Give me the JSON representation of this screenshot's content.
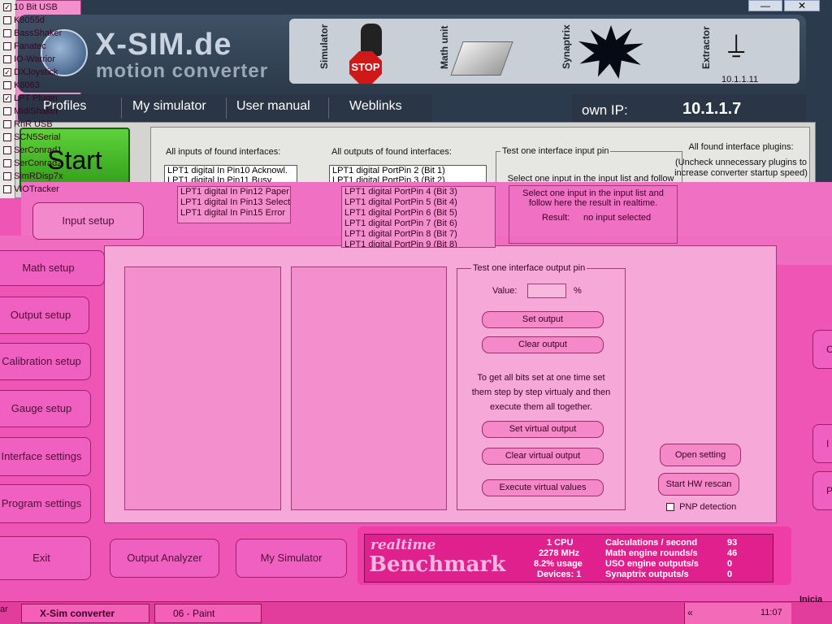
{
  "window": {
    "minimize_glyph": "—",
    "close_glyph": "✕"
  },
  "header": {
    "logo_title": "X-SIM.de",
    "logo_subtitle": "motion converter",
    "modules": {
      "simulator": "Simulator",
      "stop": "STOP",
      "math_unit": "Math unit",
      "synaptrix": "Synaptrix",
      "extractor": "Extractor",
      "extractor_ip": "10.1.1.11"
    }
  },
  "nav": {
    "profiles": "Profiles",
    "my_simulator": "My simulator",
    "user_manual": "User manual",
    "weblinks": "Weblinks"
  },
  "own_ip": {
    "label": "own IP:",
    "value": "10.1.1.7"
  },
  "start_label": "Start",
  "inputs": {
    "heading": "All inputs of found interfaces:",
    "items": [
      "LPT1 digital In Pin10 Acknowl.",
      "LPT1 digital In Pin11 Busy",
      "LPT1 digital In Pin12 Paper End",
      "LPT1 digital In Pin13 Select",
      "LPT1 digital In Pin15 Error"
    ]
  },
  "outputs": {
    "heading": "All outputs of found interfaces:",
    "items": [
      "LPT1 digital PortPin 2 (Bit 1)",
      "LPT1 digital PortPin 3 (Bit 2)",
      "LPT1 digital PortPin 4 (Bit 3)",
      "LPT1 digital PortPin 5 (Bit 4)",
      "LPT1 digital PortPin 6 (Bit 5)",
      "LPT1 digital PortPin 7 (Bit 6)",
      "LPT1 digital PortPin 8 (Bit 7)",
      "LPT1 digital PortPin 9 (Bit 8)"
    ]
  },
  "test_input": {
    "legend": "Test one interface input pin",
    "description": "Select one input in the input list and follow here the result in realtime.",
    "result_label": "Result:",
    "result_value": "no input selected"
  },
  "plugins": {
    "heading": "All found interface plugins:",
    "note": "(Uncheck unnecessary plugins to increase converter startup speed)",
    "items": [
      {
        "name": "10 Bit USB",
        "checked": true
      },
      {
        "name": "K8055d",
        "checked": false
      },
      {
        "name": "BassShaker",
        "checked": false
      },
      {
        "name": "Fanatec",
        "checked": false
      },
      {
        "name": "IO-Warrior",
        "checked": false
      },
      {
        "name": "DXJoystick",
        "checked": true
      },
      {
        "name": "K8063",
        "checked": false
      },
      {
        "name": "LPT Plugin",
        "checked": true
      },
      {
        "name": "MidiShaker",
        "checked": false
      },
      {
        "name": "RnR USB",
        "checked": false
      },
      {
        "name": "SCN5Serial",
        "checked": false
      },
      {
        "name": "SerConrad1",
        "checked": false
      },
      {
        "name": "SerConrad2",
        "checked": false
      },
      {
        "name": "SimRDisp7x",
        "checked": false
      },
      {
        "name": "VIOTracker",
        "checked": false
      }
    ],
    "open_setting": "Open setting",
    "hw_rescan": "Start HW rescan",
    "pnp_detection": "PNP detection"
  },
  "test_output": {
    "legend": "Test one interface output pin",
    "value_label": "Value:",
    "value": "",
    "percent": "%",
    "set_output": "Set output",
    "clear_output": "Clear output",
    "virtual_description": "To get all bits set at one time set them step by step virtualy and then execute them all together.",
    "set_virtual": "Set virtual output",
    "clear_virtual": "Clear virtual output",
    "execute_virtual": "Execute virtual values"
  },
  "side_menu": {
    "input_setup": "Input setup",
    "math_setup": "Math setup",
    "output_setup": "Output setup",
    "calibration_setup": "Calibration setup",
    "gauge_setup": "Gauge setup",
    "interface_settings": "Interface settings",
    "program_settings": "Program settings",
    "exit": "Exit"
  },
  "bottom": {
    "output_analyzer": "Output Analyzer",
    "my_simulator": "My Simulator"
  },
  "right_fragments": [
    "C",
    "I",
    "P"
  ],
  "benchmark": {
    "word1": "realtime",
    "word2": "Benchmark",
    "cpu": "1 CPU",
    "mhz": "2278 MHz",
    "usage": "8.2% usage",
    "devices": "Devices: 1",
    "stats": [
      {
        "label": "Calculations / second",
        "value": "93"
      },
      {
        "label": "Math engine rounds/s",
        "value": "46"
      },
      {
        "label": "USO engine outputs/s",
        "value": "0"
      },
      {
        "label": "Synaptrix outputs/s",
        "value": "0"
      }
    ]
  },
  "taskbar": {
    "start_fragment": "ar",
    "x_sim": "X-Sim converter",
    "paint": "06 - Paint",
    "tray_arrow": "«",
    "clock": "11:07",
    "iniciar": "Inicia"
  }
}
